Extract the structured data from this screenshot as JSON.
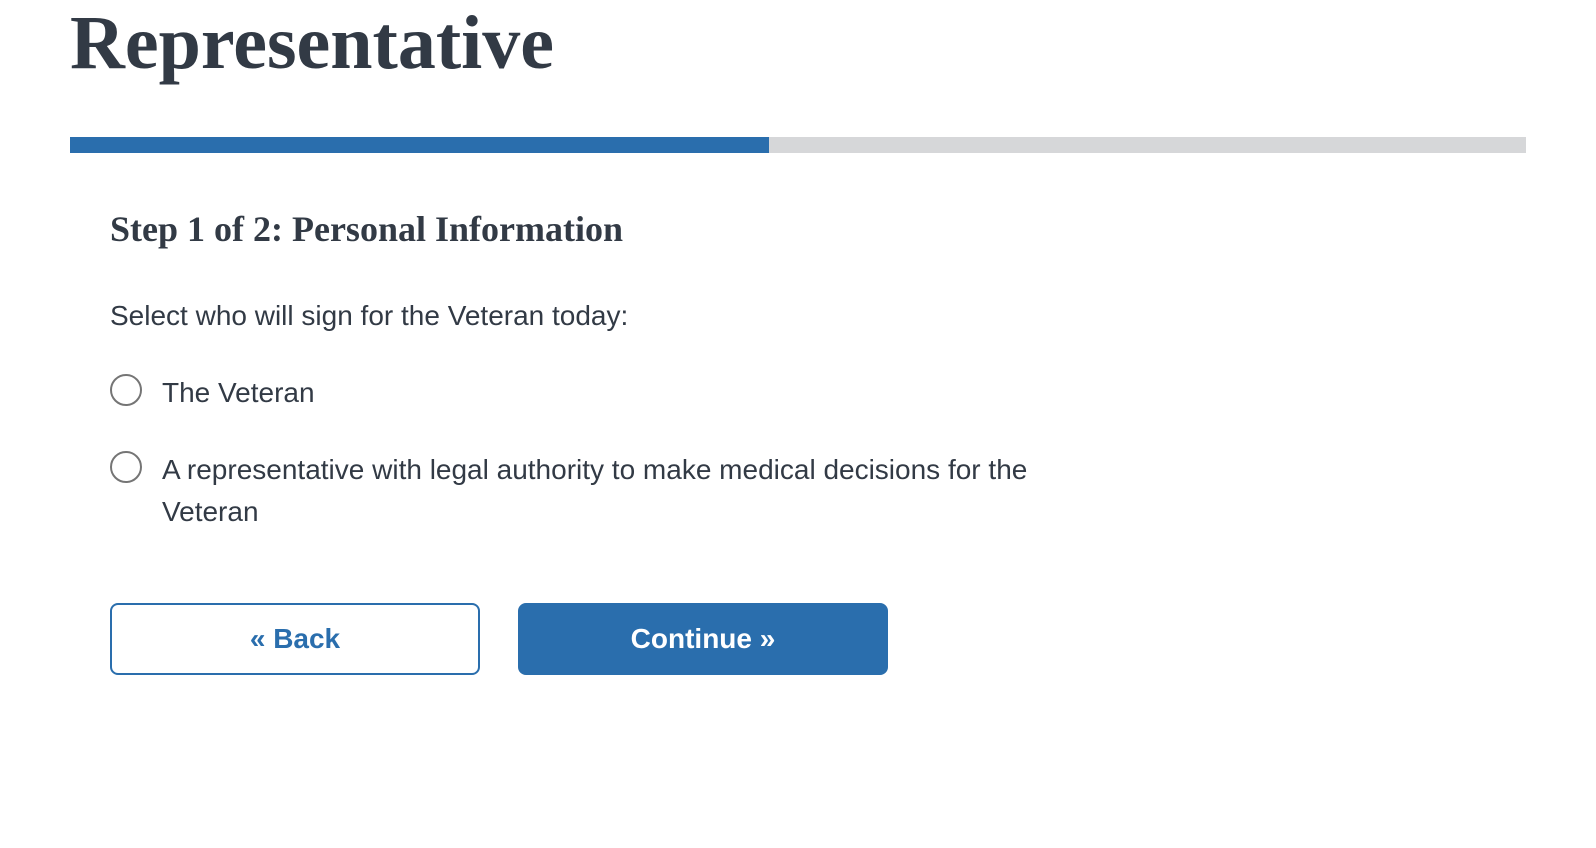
{
  "title": "Representative",
  "progress": {
    "percent": 48
  },
  "step": {
    "heading": "Step 1 of 2: Personal Information",
    "question": "Select who will sign for the Veteran today:",
    "options": [
      {
        "label": "The Veteran"
      },
      {
        "label": "A representative with legal authority to make medical decisions for the Veteran"
      }
    ]
  },
  "buttons": {
    "back": "« Back",
    "continue": "Continue »"
  }
}
